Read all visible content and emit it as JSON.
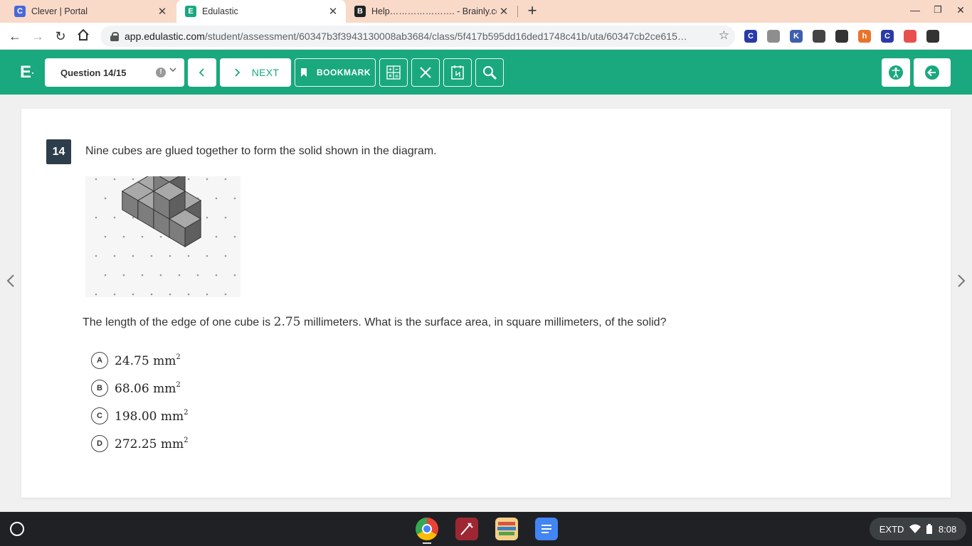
{
  "browser": {
    "tabs": [
      {
        "title": "Clever | Portal",
        "favicon_letter": "C",
        "favicon_color": "#4a68d8",
        "active": false
      },
      {
        "title": "Edulastic",
        "favicon_letter": "E",
        "favicon_color": "#1aa87e",
        "active": true
      },
      {
        "title": "Help…………………. - Brainly.com",
        "favicon_letter": "B",
        "favicon_color": "#222222",
        "active": false
      }
    ],
    "url_domain": "app.edulastic.com",
    "url_path": "/student/assessment/60347b3f3943130008ab3684/class/5f417b595dd16ded1748c41b/uta/60347cb2ce615…",
    "extensions": [
      {
        "name": "clever-extension-icon",
        "letter": "C",
        "color": "#2a3aa8"
      },
      {
        "name": "tabs-extension-icon",
        "letter": "",
        "color": "#8e8e8e"
      },
      {
        "name": "kami-extension-icon",
        "letter": "K",
        "color": "#3e5fb0"
      },
      {
        "name": "chat-extension-icon",
        "letter": "",
        "color": "#444444"
      },
      {
        "name": "target-extension-icon",
        "letter": "",
        "color": "#333333"
      },
      {
        "name": "honey-extension-icon",
        "letter": "h",
        "color": "#e8742c"
      },
      {
        "name": "clever-badge-extension-icon",
        "letter": "C",
        "color": "#2a3aa8"
      },
      {
        "name": "screencast-extension-icon",
        "letter": "",
        "color": "#e85050"
      },
      {
        "name": "puzzle-extension-icon",
        "letter": "",
        "color": "#333333"
      }
    ]
  },
  "header": {
    "logo": "E",
    "question_selector": "Question 14/15",
    "next_label": "NEXT",
    "bookmark_label": "BOOKMARK",
    "accent_color": "#1aa87e"
  },
  "question": {
    "number": "14",
    "prompt": "Nine cubes are glued together to form the solid shown in the diagram.",
    "text_before": "The length of the edge of one cube is ",
    "edge_value": "2.75",
    "text_after": " millimeters.  What is the surface area, in square millimeters, of the solid?",
    "choices": [
      {
        "letter": "A",
        "value": "24.75 mm",
        "exp": "2"
      },
      {
        "letter": "B",
        "value": "68.06 mm",
        "exp": "2"
      },
      {
        "letter": "C",
        "value": "198.00 mm",
        "exp": "2"
      },
      {
        "letter": "D",
        "value": "272.25 mm",
        "exp": "2"
      }
    ]
  },
  "taskbar": {
    "tray_label": "EXTD",
    "time": "8:08"
  }
}
